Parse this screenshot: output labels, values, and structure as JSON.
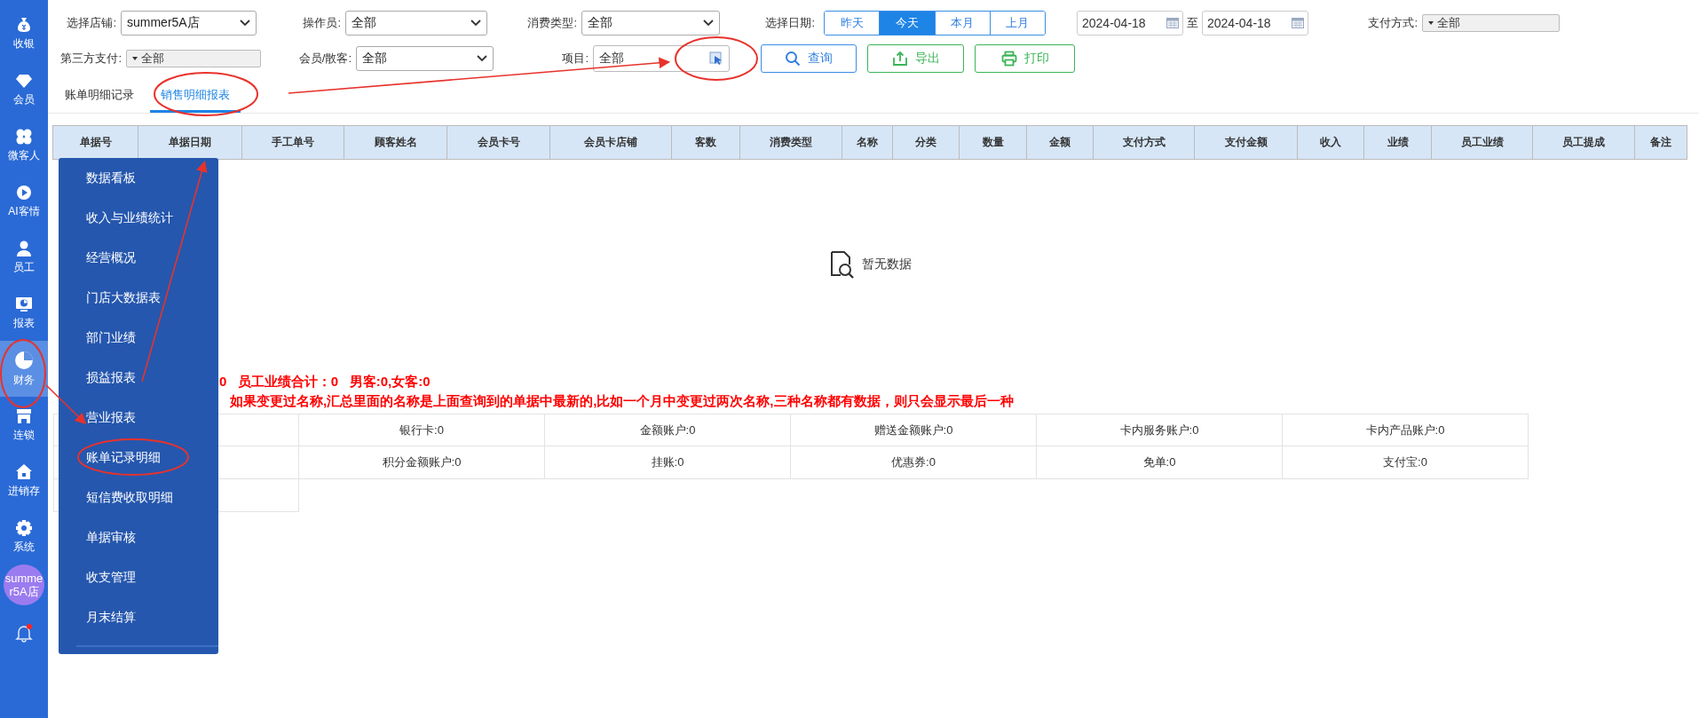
{
  "sidebar": {
    "items": [
      {
        "label": "收银",
        "selected": false
      },
      {
        "label": "会员",
        "selected": false
      },
      {
        "label": "微客人",
        "selected": false
      },
      {
        "label": "AI客情",
        "selected": false
      },
      {
        "label": "员工",
        "selected": false
      },
      {
        "label": "报表",
        "selected": false
      },
      {
        "label": "财务",
        "selected": true
      },
      {
        "label": "连锁",
        "selected": false
      },
      {
        "label": "进销存",
        "selected": false
      },
      {
        "label": "系统",
        "selected": false
      }
    ],
    "avatar": "summer5A店"
  },
  "filter_rows": [
    [
      {
        "kind": "select",
        "label": "选择店铺:",
        "value": "summer5A店"
      },
      {
        "kind": "select",
        "label": "操作员:",
        "value": "全部"
      },
      {
        "kind": "select",
        "label": "消费类型:",
        "value": "全部"
      },
      {
        "kind": "segmented",
        "label": "选择日期:",
        "options": [
          {
            "label": "昨天",
            "selected": false
          },
          {
            "label": "今天",
            "selected": true
          },
          {
            "label": "本月",
            "selected": false
          },
          {
            "label": "上月",
            "selected": false
          }
        ]
      },
      {
        "kind": "daterange",
        "from": "2024-04-18",
        "separator": "至",
        "to": "2024-04-18"
      },
      {
        "kind": "combo",
        "label": "支付方式:",
        "value": "全部"
      }
    ],
    [
      {
        "kind": "combo",
        "label": "第三方支付:",
        "value": "全部"
      },
      {
        "kind": "select",
        "label": "会员/散客:",
        "value": "全部"
      },
      {
        "kind": "picker",
        "label": "项目:",
        "value": "全部"
      },
      {
        "kind": "button",
        "label": "查询"
      },
      {
        "kind": "button",
        "label": "导出"
      },
      {
        "kind": "button",
        "label": "打印"
      }
    ]
  ],
  "tabs": [
    {
      "label": "账单明细记录",
      "selected": false
    },
    {
      "label": "销售明细报表",
      "selected": true
    }
  ],
  "table": {
    "columns": [
      "单据号",
      "单据日期",
      "手工单号",
      "顾客姓名",
      "会员卡号",
      "会员卡店铺",
      "客数",
      "消费类型",
      "名称",
      "分类",
      "数量",
      "金额",
      "支付方式",
      "支付金额",
      "收入",
      "业绩",
      "员工业绩",
      "员工提成",
      "备注"
    ],
    "empty_message": "暂无数据"
  },
  "summary_lines": [
    "0   员工业绩合计：0   男客:0,女客:0",
    "如果变更过名称,汇总里面的名称是上面查询到的单据中最新的,比如一个月中变更过两次名称,三种名称都有数据，则只会显示最后一种"
  ],
  "summary_grid": {
    "rows": [
      [
        "银行卡:0",
        "金额账户:0",
        "赠送金额账户:0",
        "卡内服务账户:0",
        "卡内产品账户:0"
      ],
      [
        "积分金额账户:0",
        "挂账:0",
        "优惠券:0",
        "免单:0",
        "支付宝:0"
      ]
    ]
  },
  "flyout_menu": {
    "items": [
      "数据看板",
      "收入与业绩统计",
      "经营概况",
      "门店大数据表",
      "部门业绩",
      "损益报表",
      "营业报表",
      "账单记录明细",
      "短信费收取明细",
      "单据审核",
      "收支管理",
      "月末结算"
    ]
  }
}
